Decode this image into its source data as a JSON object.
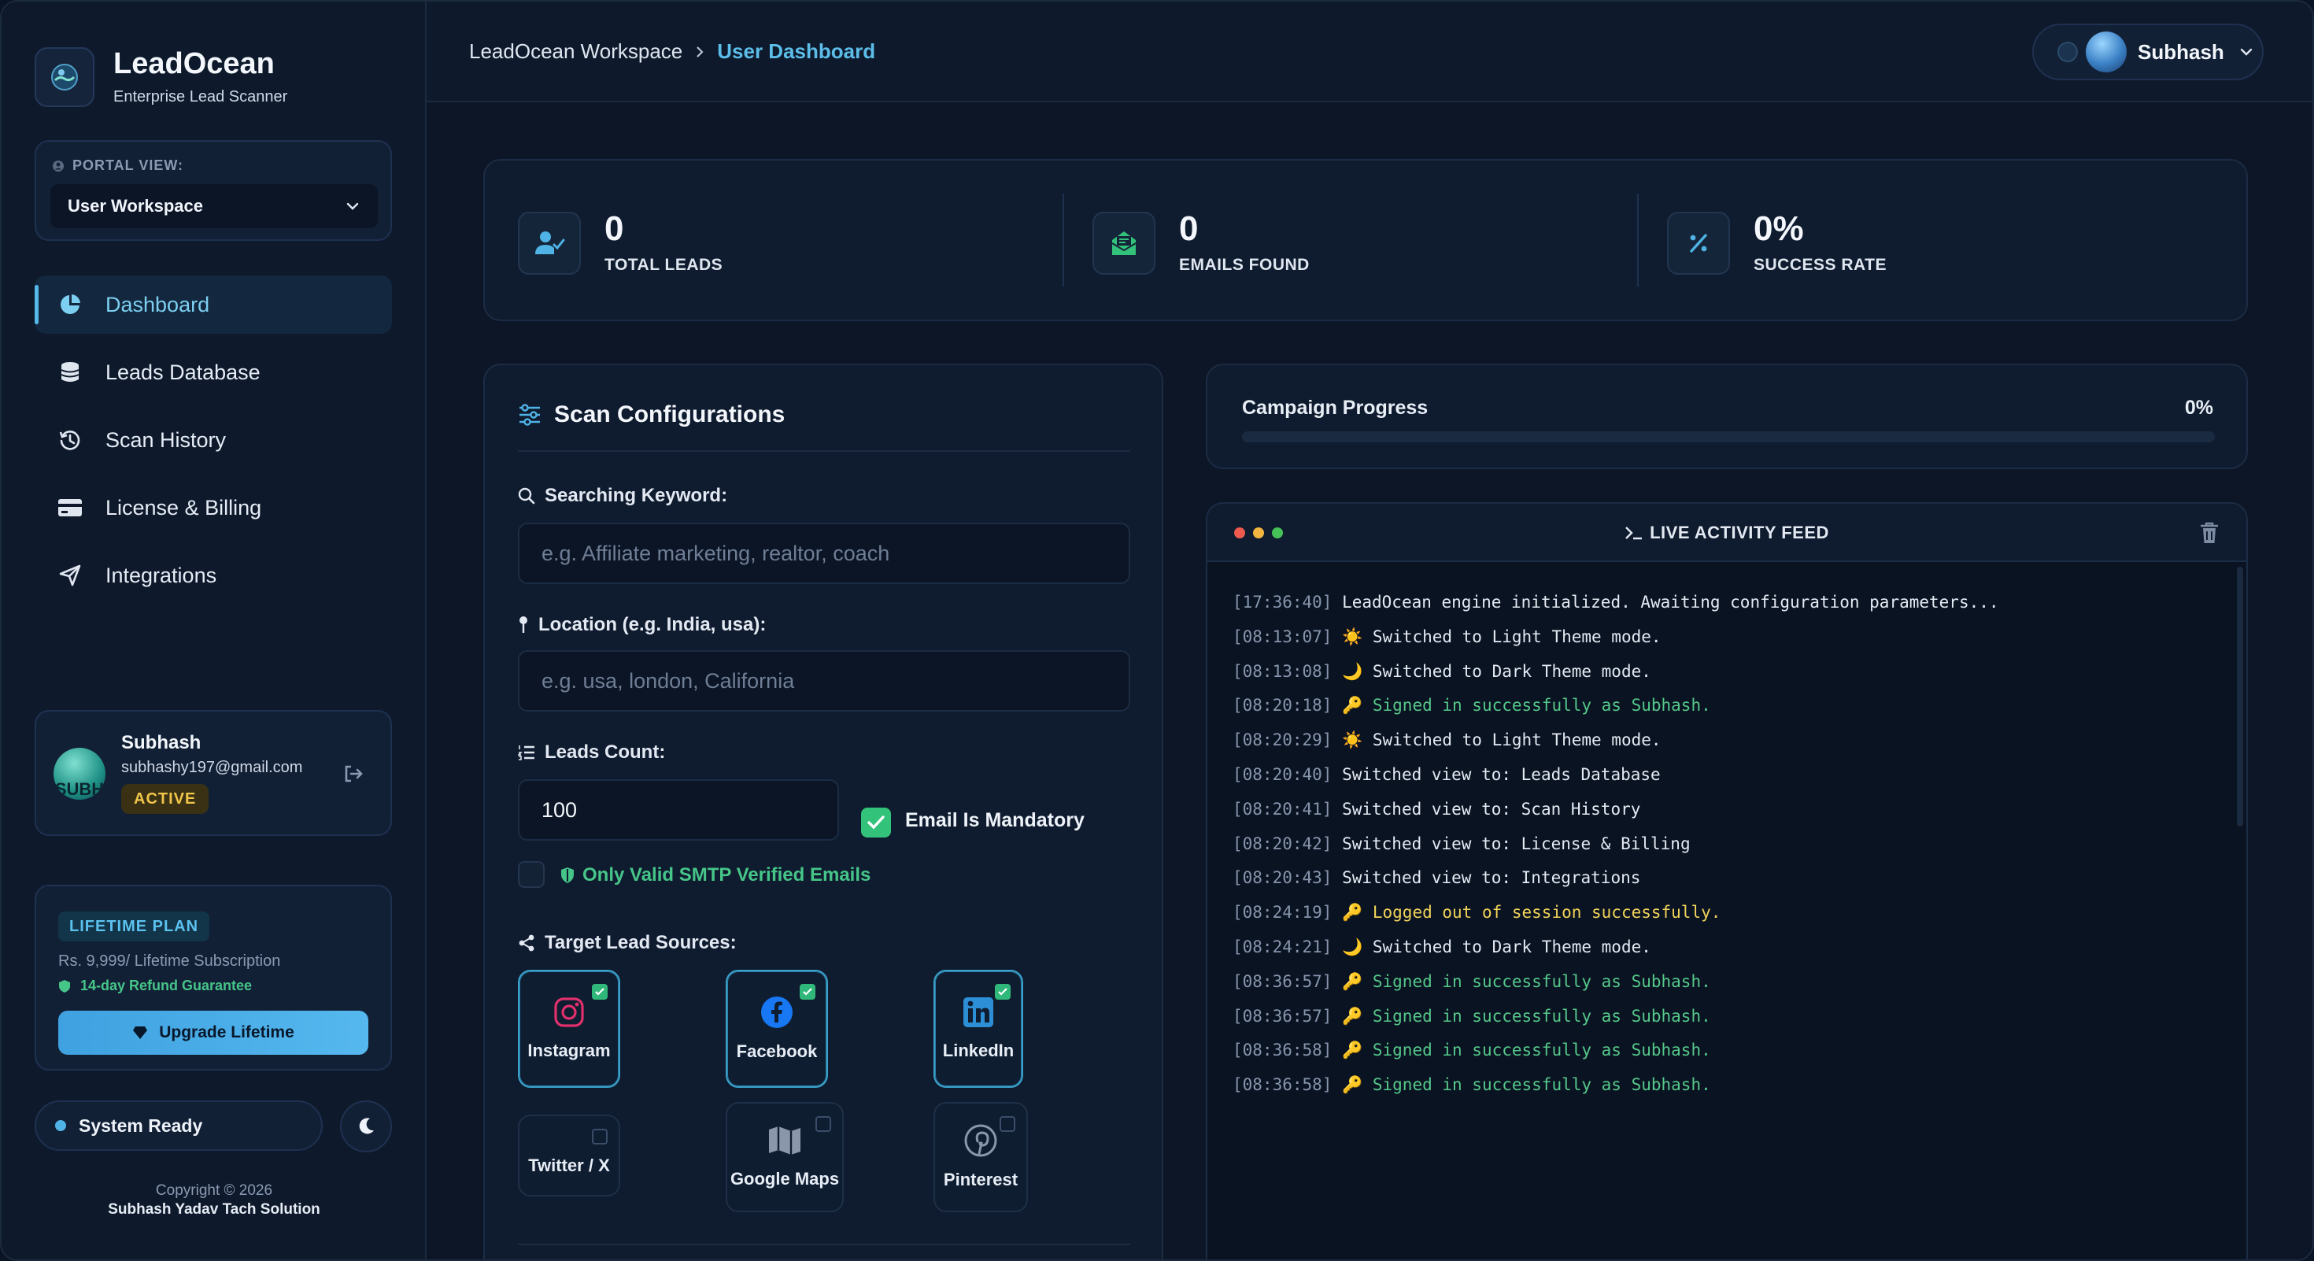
{
  "brand": {
    "title": "LeadOcean",
    "subtitle": "Enterprise Lead Scanner"
  },
  "portal": {
    "label": "PORTAL VIEW:",
    "value": "User Workspace"
  },
  "nav": [
    {
      "label": "Dashboard",
      "icon": "pie-chart-icon",
      "active": true
    },
    {
      "label": "Leads Database",
      "icon": "database-icon"
    },
    {
      "label": "Scan History",
      "icon": "history-icon"
    },
    {
      "label": "License & Billing",
      "icon": "credit-card-icon"
    },
    {
      "label": "Integrations",
      "icon": "send-icon"
    }
  ],
  "user": {
    "name": "Subhash",
    "email": "subhashy197@gmail.com",
    "status": "ACTIVE",
    "avatar_text": "SUBH"
  },
  "plan": {
    "badge": "LIFETIME PLAN",
    "price": "Rs. 9,999/ Lifetime Subscription",
    "refund": "14-day Refund Guarantee",
    "button": "Upgrade Lifetime"
  },
  "system": {
    "status": "System Ready"
  },
  "footer": {
    "copyright": "Copyright © 2026",
    "company": "Subhash Yadav Tach Solution"
  },
  "header": {
    "breadcrumb_root": "LeadOcean Workspace",
    "breadcrumb_current": "User Dashboard",
    "profile_name": "Subhash"
  },
  "stats": [
    {
      "value": "0",
      "label": "TOTAL LEADS",
      "icon": "user-check-icon"
    },
    {
      "value": "0",
      "label": "EMAILS FOUND",
      "icon": "envelope-open-icon"
    },
    {
      "value": "0%",
      "label": "SUCCESS RATE",
      "icon": "percent-icon"
    }
  ],
  "config": {
    "title": "Scan Configurations",
    "keyword_label": "Searching Keyword:",
    "keyword_placeholder": "e.g. Affiliate marketing, realtor, coach",
    "location_label": "Location (e.g. India, usa):",
    "location_placeholder": "e.g. usa, london, California",
    "count_label": "Leads Count:",
    "count_value": "100",
    "email_mandatory_label": "Email Is Mandatory",
    "email_mandatory_checked": true,
    "smtp_label": "Only Valid SMTP Verified Emails",
    "smtp_checked": false,
    "sources_label": "Target Lead Sources:",
    "sources": [
      {
        "label": "Instagram",
        "icon": "instagram-icon",
        "selected": true
      },
      {
        "label": "Facebook",
        "icon": "facebook-icon",
        "selected": true
      },
      {
        "label": "LinkedIn",
        "icon": "linkedin-icon",
        "selected": true
      },
      {
        "label": "Twitter / X",
        "icon": "twitter-x-icon",
        "selected": false
      },
      {
        "label": "Google Maps",
        "icon": "map-icon",
        "selected": false
      },
      {
        "label": "Pinterest",
        "icon": "pinterest-icon",
        "selected": false
      }
    ]
  },
  "progress": {
    "title": "Campaign Progress",
    "percent_label": "0%",
    "value": 0
  },
  "feed": {
    "title": "LIVE ACTIVITY FEED",
    "lines": [
      {
        "ts": "[17:36:40]",
        "text": "LeadOcean engine initialized. Awaiting configuration parameters...",
        "tone": "normal"
      },
      {
        "ts": "[08:13:07]",
        "text": "☀️ Switched to Light Theme mode.",
        "tone": "normal"
      },
      {
        "ts": "[08:13:08]",
        "text": "🌙 Switched to Dark Theme mode.",
        "tone": "normal"
      },
      {
        "ts": "[08:20:18]",
        "text": "🔑 Signed in successfully as Subhash.",
        "tone": "ok"
      },
      {
        "ts": "[08:20:29]",
        "text": "☀️ Switched to Light Theme mode.",
        "tone": "normal"
      },
      {
        "ts": "[08:20:40]",
        "text": "Switched view to: Leads Database",
        "tone": "normal"
      },
      {
        "ts": "[08:20:41]",
        "text": "Switched view to: Scan History",
        "tone": "normal"
      },
      {
        "ts": "[08:20:42]",
        "text": "Switched view to: License & Billing",
        "tone": "normal"
      },
      {
        "ts": "[08:20:43]",
        "text": "Switched view to: Integrations",
        "tone": "normal"
      },
      {
        "ts": "[08:24:19]",
        "text": "🔑 Logged out of session successfully.",
        "tone": "warn"
      },
      {
        "ts": "[08:24:21]",
        "text": "🌙 Switched to Dark Theme mode.",
        "tone": "normal"
      },
      {
        "ts": "[08:36:57]",
        "text": "🔑 Signed in successfully as Subhash.",
        "tone": "ok"
      },
      {
        "ts": "[08:36:57]",
        "text": "🔑 Signed in successfully as Subhash.",
        "tone": "ok"
      },
      {
        "ts": "[08:36:58]",
        "text": "🔑 Signed in successfully as Subhash.",
        "tone": "ok"
      },
      {
        "ts": "[08:36:58]",
        "text": "🔑 Signed in successfully as Subhash.",
        "tone": "ok"
      }
    ]
  },
  "colors": {
    "accent": "#55b8e8",
    "success": "#32c27a",
    "warning": "#f0c54a",
    "background": "#0c1626"
  }
}
